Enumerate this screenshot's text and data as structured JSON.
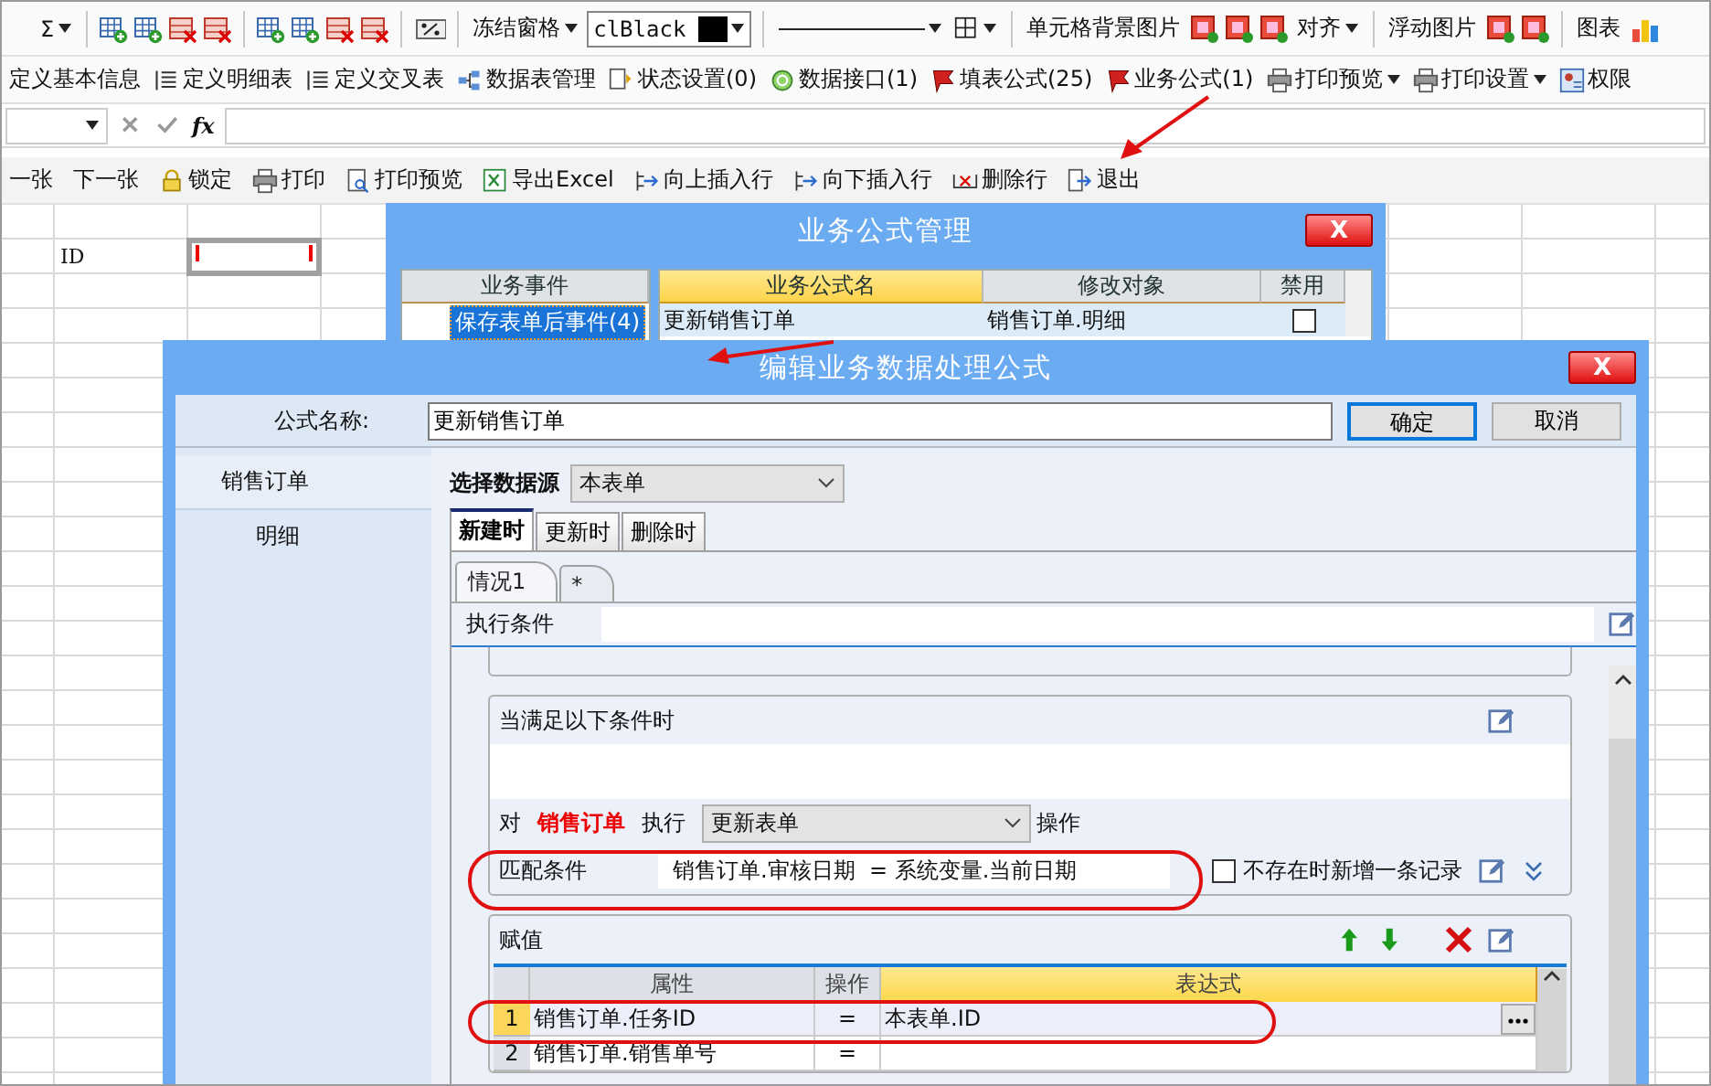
{
  "format_toolbar": {
    "sum_label": "Σ",
    "freeze_label": "冻结窗格",
    "font_color": "clBlack",
    "cell_bg_label": "单元格背景图片",
    "align_label": "对齐",
    "float_image_label": "浮动图片",
    "chart_label": "图表"
  },
  "design_toolbar": {
    "items": [
      {
        "kind": "text",
        "label": "定义基本信息",
        "has_menu": false
      },
      {
        "kind": "icon_text",
        "label": "定义明细表",
        "has_menu": false
      },
      {
        "kind": "icon_text",
        "label": "定义交叉表",
        "has_menu": false
      },
      {
        "kind": "icon_text",
        "label": "数据表管理",
        "has_menu": false
      },
      {
        "kind": "icon_text",
        "label": "状态设置(0)",
        "has_menu": false
      },
      {
        "kind": "icon_text",
        "label": "数据接口(1)",
        "has_menu": false
      },
      {
        "kind": "icon_text",
        "label": "填表公式(25)",
        "has_menu": false
      },
      {
        "kind": "icon_text",
        "label": "业务公式(1)",
        "has_menu": false
      },
      {
        "kind": "icon_text",
        "label": "打印预览",
        "has_menu": true
      },
      {
        "kind": "icon_text",
        "label": "打印设置",
        "has_menu": true
      },
      {
        "kind": "icon_text",
        "label": "权限",
        "has_menu": false
      }
    ]
  },
  "formula_bar": {
    "fx_label": "fx"
  },
  "form_toolbar": {
    "items": [
      {
        "kind": "text",
        "label": "一张"
      },
      {
        "kind": "text",
        "label": "下一张"
      },
      {
        "kind": "icon_text",
        "label": "锁定"
      },
      {
        "kind": "icon_text",
        "label": "打印"
      },
      {
        "kind": "icon_text",
        "label": "打印预览"
      },
      {
        "kind": "icon_text",
        "label": "导出Excel"
      },
      {
        "kind": "icon_text",
        "label": "向上插入行"
      },
      {
        "kind": "icon_text",
        "label": "向下插入行"
      },
      {
        "kind": "icon_text",
        "label": "删除行"
      },
      {
        "kind": "icon_text",
        "label": "退出"
      }
    ]
  },
  "sheet": {
    "id_cell": "ID"
  },
  "formula_manager": {
    "title": "业务公式管理",
    "close_label": "X",
    "events_header": "业务事件",
    "events": [
      {
        "label": "保存表单后事件(4)",
        "selected": true
      }
    ],
    "columns": [
      "业务公式名",
      "修改对象",
      "禁用"
    ],
    "rows": [
      {
        "name": "更新销售订单",
        "target": "销售订单.明细",
        "disabled": false
      }
    ]
  },
  "editor": {
    "title": "编辑业务数据处理公式",
    "close_label": "X",
    "name_label": "公式名称:",
    "name_value": "更新销售订单",
    "buttons": [
      {
        "label": "确定",
        "selected": true
      },
      {
        "label": "取消",
        "selected": false
      }
    ],
    "tables": [
      {
        "label": "销售订单",
        "selected": true
      },
      {
        "label": "明细",
        "selected": false
      }
    ],
    "source_label": "选择数据源",
    "source_value": "本表单",
    "tabs": [
      {
        "label": "新建时",
        "selected": true
      },
      {
        "label": "更新时",
        "selected": false
      },
      {
        "label": "删除时",
        "selected": false
      }
    ],
    "cases": [
      {
        "label": "情况1",
        "selected": true
      },
      {
        "label": "*",
        "selected": false
      }
    ],
    "exec_condition_label": "执行条件",
    "condition_group_label": "当满足以下条件时",
    "target_prefix": "对",
    "target_table": "销售订单",
    "exec_label": "执行",
    "action_value": "更新表单",
    "action_suffix": "操作",
    "match_label": "匹配条件",
    "match_expression": "销售订单.审核日期  = 系统变量.当前日期",
    "add_if_missing": {
      "label": "不存在时新增一条记录",
      "checked": false
    },
    "assign_label": "赋值",
    "assign_columns": [
      "属性",
      "操作",
      "表达式"
    ],
    "assign_rows": [
      {
        "index": "1",
        "property": "销售订单.任务ID",
        "op": "=",
        "expression": "本表单.ID",
        "selected": true
      },
      {
        "index": "2",
        "property": "销售订单.销售单号",
        "op": "=",
        "selected": false
      }
    ]
  }
}
